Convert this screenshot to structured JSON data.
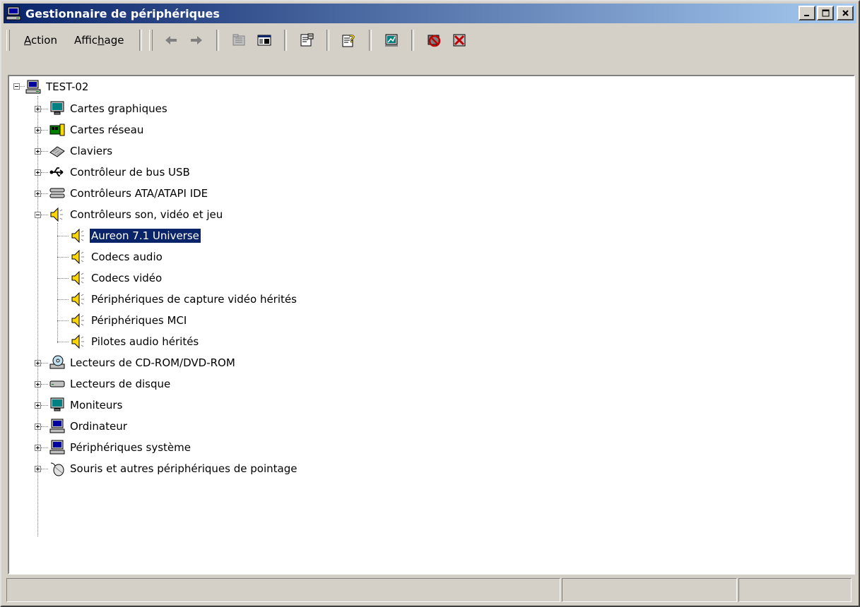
{
  "window": {
    "title": "Gestionnaire de périphériques",
    "controls": {
      "minimize": "minimize",
      "maximize": "maximize",
      "close": "close"
    }
  },
  "toolbar": {
    "menu": [
      {
        "id": "action",
        "label_prefix": "",
        "label_accel": "A",
        "label_suffix": "ction"
      },
      {
        "id": "affichage",
        "label_prefix": "Affic",
        "label_accel": "h",
        "label_suffix": "age"
      }
    ],
    "buttons": [
      "back-arrow-icon",
      "forward-arrow-icon",
      "up-folder-icon",
      "show-hide-console-tree-icon",
      "properties-icon",
      "help-icon",
      "scan-hardware-icon",
      "disable-device-icon",
      "uninstall-device-icon"
    ]
  },
  "tree": {
    "root": {
      "label": "TEST-02",
      "expanded": true
    },
    "categories": [
      {
        "label": "Cartes graphiques",
        "icon": "monitor-icon",
        "expanded": false
      },
      {
        "label": "Cartes réseau",
        "icon": "network-card-icon",
        "expanded": false
      },
      {
        "label": "Claviers",
        "icon": "keyboard-icon",
        "expanded": false
      },
      {
        "label": "Contrôleur de bus USB",
        "icon": "usb-icon",
        "expanded": false
      },
      {
        "label": "Contrôleurs ATA/ATAPI IDE",
        "icon": "ide-controller-icon",
        "expanded": false
      },
      {
        "label": "Contrôleurs son, vidéo et jeu",
        "icon": "speaker-icon",
        "expanded": true,
        "children": [
          {
            "label": "Aureon 7.1 Universe",
            "selected": true
          },
          {
            "label": "Codecs audio"
          },
          {
            "label": "Codecs vidéo"
          },
          {
            "label": "Périphériques de capture vidéo hérités"
          },
          {
            "label": "Périphériques MCI"
          },
          {
            "label": "Pilotes audio hérités"
          }
        ]
      },
      {
        "label": "Lecteurs de CD-ROM/DVD-ROM",
        "icon": "cdrom-icon",
        "expanded": false
      },
      {
        "label": "Lecteurs de disque",
        "icon": "disk-drive-icon",
        "expanded": false
      },
      {
        "label": "Moniteurs",
        "icon": "monitor-icon",
        "expanded": false
      },
      {
        "label": "Ordinateur",
        "icon": "computer-icon",
        "expanded": false
      },
      {
        "label": "Périphériques système",
        "icon": "computer-icon",
        "expanded": false
      },
      {
        "label": "Souris et autres périphériques de pointage",
        "icon": "mouse-icon",
        "expanded": false
      }
    ]
  },
  "statusbar": {
    "panels": [
      "",
      "",
      ""
    ]
  },
  "colors": {
    "titlebar_start": "#0a246a",
    "titlebar_end": "#a6caf0",
    "selection": "#0a246a",
    "face": "#d4d0c8"
  }
}
